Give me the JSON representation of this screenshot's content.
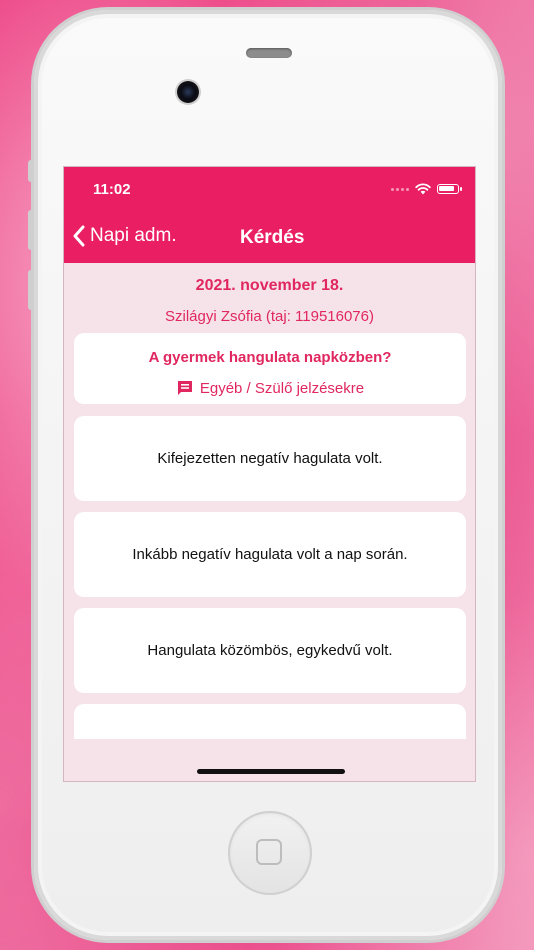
{
  "status_bar": {
    "time": "11:02"
  },
  "nav": {
    "back_label": "Napi adm.",
    "title": "Kérdés"
  },
  "content": {
    "date": "2021. november 18.",
    "patient": "Szilágyi Zsófia (taj: 119516076)",
    "question": "A gyermek hangulata napközben?",
    "extra_link": "Egyéb / Szülő jelzésekre",
    "answers": [
      "Kifejezetten negatív hagulata volt.",
      "Inkább negatív hagulata volt a nap során.",
      "Hangulata közömbös, egykedvű volt.",
      ""
    ]
  },
  "colors": {
    "accent": "#e91e63",
    "screen_bg": "#f6e3ea",
    "card_bg": "#ffffff"
  },
  "icons": [
    "chevron-left-icon",
    "wifi-icon",
    "battery-icon",
    "comment-icon"
  ]
}
